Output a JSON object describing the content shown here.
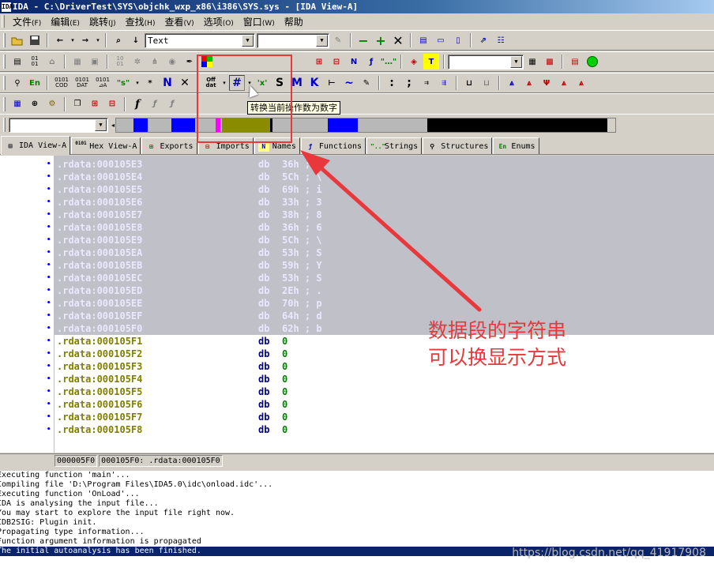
{
  "title": {
    "app_icon": "IDA",
    "text": "IDA - C:\\DriverTest\\SYS\\objchk_wxp_x86\\i386\\SYS.sys - [IDA View-A]"
  },
  "menu": [
    {
      "label": "文件",
      "key": "(F)"
    },
    {
      "label": "编辑",
      "key": "(E)"
    },
    {
      "label": "跳转",
      "key": "(J)"
    },
    {
      "label": "查找",
      "key": "(H)"
    },
    {
      "label": "查看",
      "key": "(V)"
    },
    {
      "label": "选项",
      "key": "(O)"
    },
    {
      "label": "窗口",
      "key": "(W)"
    },
    {
      "label": "帮助",
      "key": ""
    }
  ],
  "toolbar": {
    "text_combo_value": "Text",
    "tooltip": "转换当前操作数为数字",
    "btn_en": "En",
    "btn_cod": "0101 COD",
    "btn_dat": "0101 DAT",
    "btn_da": "0101 ⊿A",
    "btn_s_str": "\"s\"",
    "btn_star": "*",
    "btn_n": "N",
    "btn_x": "✕",
    "btn_offdat": "Off dat",
    "btn_hash": "#",
    "btn_x_str": "'x'",
    "btn_s": "S",
    "btn_m": "M",
    "btn_k": "K",
    "btn_tilde": "~",
    "btn_f": "f",
    "btn_n2": "N",
    "btn_t": "T",
    "btn_colon": ":",
    "btn_semicolon": ";"
  },
  "tabs": [
    {
      "label": "IDA View-A",
      "icon": "ida-view-icon",
      "active": true
    },
    {
      "label": "Hex View-A",
      "icon": "hex-view-icon",
      "active": false
    },
    {
      "label": "Exports",
      "icon": "exports-icon",
      "active": false
    },
    {
      "label": "Imports",
      "icon": "imports-icon",
      "active": false
    },
    {
      "label": "Names",
      "icon": "names-icon",
      "active": false
    },
    {
      "label": "Functions",
      "icon": "functions-icon",
      "active": false
    },
    {
      "label": "Strings",
      "icon": "strings-icon",
      "active": false
    },
    {
      "label": "Structures",
      "icon": "structures-icon",
      "active": false
    },
    {
      "label": "Enums",
      "icon": "enums-icon",
      "active": false
    }
  ],
  "tab_icon_text": {
    "hex": "0101",
    "names": "N",
    "strings": "\"..\"",
    "enums": "En"
  },
  "disasm": {
    "selected_lines": [
      {
        "addr": ".rdata:000105E3",
        "mnem": "db",
        "op": "36h ; 6"
      },
      {
        "addr": ".rdata:000105E4",
        "mnem": "db",
        "op": "5Ch ; \\"
      },
      {
        "addr": ".rdata:000105E5",
        "mnem": "db",
        "op": "69h ; i"
      },
      {
        "addr": ".rdata:000105E6",
        "mnem": "db",
        "op": "33h ; 3"
      },
      {
        "addr": ".rdata:000105E7",
        "mnem": "db",
        "op": "38h ; 8"
      },
      {
        "addr": ".rdata:000105E8",
        "mnem": "db",
        "op": "36h ; 6"
      },
      {
        "addr": ".rdata:000105E9",
        "mnem": "db",
        "op": "5Ch ; \\"
      },
      {
        "addr": ".rdata:000105EA",
        "mnem": "db",
        "op": "53h ; S"
      },
      {
        "addr": ".rdata:000105EB",
        "mnem": "db",
        "op": "59h ; Y"
      },
      {
        "addr": ".rdata:000105EC",
        "mnem": "db",
        "op": "53h ; S"
      },
      {
        "addr": ".rdata:000105ED",
        "mnem": "db",
        "op": "2Eh ; ."
      },
      {
        "addr": ".rdata:000105EE",
        "mnem": "db",
        "op": "70h ; p"
      },
      {
        "addr": ".rdata:000105EF",
        "mnem": "db",
        "op": "64h ; d"
      },
      {
        "addr": ".rdata:000105F0",
        "mnem": "db",
        "op": "62h ; b"
      }
    ],
    "normal_lines": [
      {
        "addr": ".rdata:000105F1",
        "mnem": "db",
        "op": "0"
      },
      {
        "addr": ".rdata:000105F2",
        "mnem": "db",
        "op": "0"
      },
      {
        "addr": ".rdata:000105F3",
        "mnem": "db",
        "op": "0"
      },
      {
        "addr": ".rdata:000105F4",
        "mnem": "db",
        "op": "0"
      },
      {
        "addr": ".rdata:000105F5",
        "mnem": "db",
        "op": "0"
      },
      {
        "addr": ".rdata:000105F6",
        "mnem": "db",
        "op": "0"
      },
      {
        "addr": ".rdata:000105F7",
        "mnem": "db",
        "op": "0"
      },
      {
        "addr": ".rdata:000105F8",
        "mnem": "db",
        "op": "0"
      }
    ]
  },
  "status": {
    "offset": "000005F0",
    "location": "000105F0: .rdata:000105F0"
  },
  "output_lines": [
    "Executing function 'main'...",
    "Compiling file 'D:\\Program Files\\IDA5.0\\idc\\onload.idc'...",
    "Executing function 'OnLoad'...",
    "IDA is analysing the input file...",
    "You may start to explore the input file right now.",
    "IDB2SIG: Plugin init.",
    "Propagating type information...",
    "Function argument information is propagated",
    "The initial autoanalysis has been finished."
  ],
  "watermark": "https://blog.csdn.net/qq_41917908",
  "annotation": {
    "line1": "数据段的字符串",
    "line2": "可以换显示方式",
    "color": "#e8383b"
  },
  "colors": {
    "title_bar": "#0a246a",
    "selection": "#c0c0c8",
    "address_olive": "#808000",
    "mnemonic_navy": "#000080",
    "operand_green": "#008000"
  }
}
